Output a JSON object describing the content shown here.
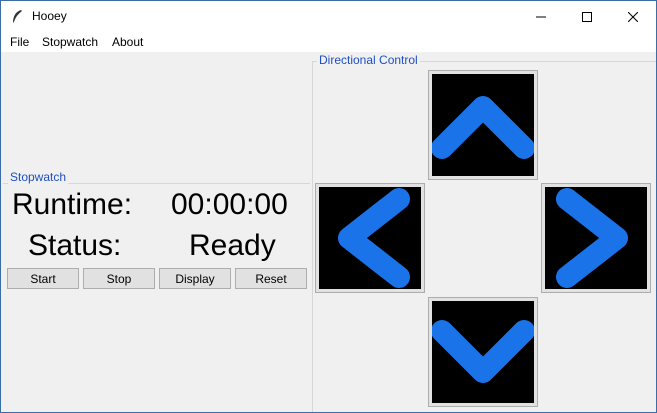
{
  "window": {
    "title": "Hooey",
    "app_icon": "feather-icon",
    "controls": [
      "minimize-icon",
      "maximize-icon",
      "close-icon"
    ]
  },
  "menubar": {
    "items": [
      "File",
      "Stopwatch",
      "About"
    ]
  },
  "stopwatch": {
    "frame_label": "Stopwatch",
    "runtime_label": "Runtime:",
    "runtime_value": "00:00:00",
    "status_label": "Status:",
    "status_value": "Ready",
    "buttons": [
      "Start",
      "Stop",
      "Display",
      "Reset"
    ]
  },
  "directional": {
    "frame_label": "Directional Control",
    "buttons": [
      "up-arrow-icon",
      "left-arrow-icon",
      "right-arrow-icon",
      "down-arrow-icon"
    ],
    "arrow_color": "#1a73e8",
    "button_background": "#000000"
  },
  "colors": {
    "frame_label": "#1f4fc0",
    "window_bg": "#f0f0f0"
  }
}
